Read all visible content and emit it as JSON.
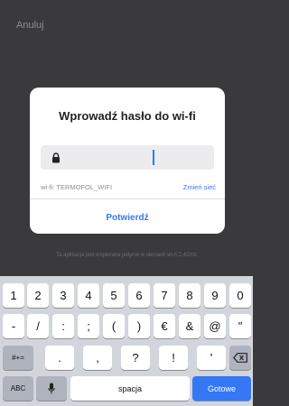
{
  "header": {
    "cancel_label": "Anuluj"
  },
  "dialog": {
    "title": "Wprowadź hasło do wi-fi",
    "password_value": "",
    "network_text": "wi-fi: TERMOFOL_WIFI",
    "change_network_label": "Zmień sieć",
    "confirm_label": "Potwierdź"
  },
  "note": "Ta aplikacja jest wspierana jedynie w sieciach wi-fi 2,4GHz",
  "keyboard": {
    "row1": [
      "1",
      "2",
      "3",
      "4",
      "5",
      "6",
      "7",
      "8",
      "9",
      "0"
    ],
    "row2": [
      "-",
      "/",
      ":",
      ";",
      "(",
      ")",
      "€",
      "&",
      "@",
      "\""
    ],
    "row3_left": "#+=",
    "row3": [
      ".",
      ",",
      "?",
      "!",
      "'"
    ],
    "abc_label": "ABC",
    "space_label": "spacja",
    "done_label": "Gotowe"
  },
  "colors": {
    "accent": "#3478f6",
    "background": "#3a3a3c",
    "keyboard": "#d2d5db"
  }
}
